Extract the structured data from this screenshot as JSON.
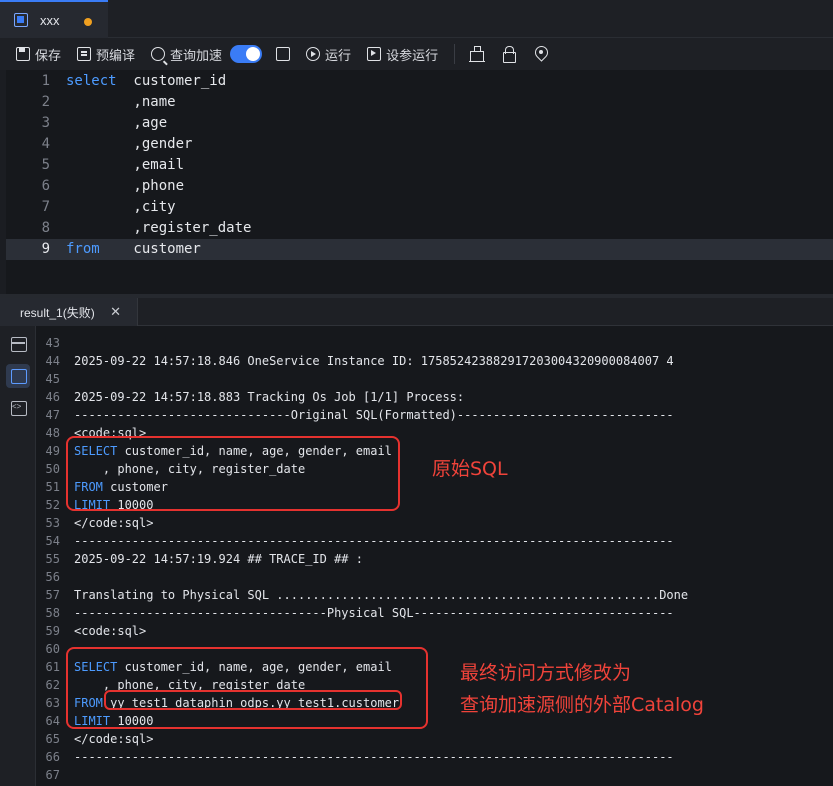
{
  "tab": {
    "title": "xxx",
    "unsaved_color": "#f0a020",
    "icon": "sql-file-icon"
  },
  "toolbar": {
    "save": "保存",
    "precompile": "预编译",
    "query_accel": "查询加速",
    "query_accel_enabled": true,
    "run": "运行",
    "run_with_params": "设参运行",
    "icons": [
      "save-icon",
      "precompile-icon",
      "search-icon",
      "edit-icon",
      "play-icon",
      "debug-run-icon",
      "warehouse-icon",
      "lock-icon",
      "location-pin-icon"
    ]
  },
  "editor": {
    "active_line": 9,
    "lines": [
      {
        "n": "1",
        "kw": "select",
        "code": "  customer_id"
      },
      {
        "n": "2",
        "kw": "",
        "code": "        ,name"
      },
      {
        "n": "3",
        "kw": "",
        "code": "        ,age"
      },
      {
        "n": "4",
        "kw": "",
        "code": "        ,gender"
      },
      {
        "n": "5",
        "kw": "",
        "code": "        ,email"
      },
      {
        "n": "6",
        "kw": "",
        "code": "        ,phone"
      },
      {
        "n": "7",
        "kw": "",
        "code": "        ,city"
      },
      {
        "n": "8",
        "kw": "",
        "code": "        ,register_date"
      },
      {
        "n": "9",
        "kw": "from",
        "code": "    customer"
      }
    ]
  },
  "result": {
    "tab_label": "result_1(失败)",
    "close_label": "✕",
    "side_icons": [
      "table-grid-icon",
      "log-icon",
      "code-icon"
    ],
    "log_lines": [
      {
        "n": "43",
        "kw": "",
        "text": ""
      },
      {
        "n": "44",
        "kw": "",
        "text": "2025-09-22 14:57:18.846 OneService Instance ID: 175852423882917203004320900084007 4"
      },
      {
        "n": "45",
        "kw": "",
        "text": ""
      },
      {
        "n": "46",
        "kw": "",
        "text": "2025-09-22 14:57:18.883 Tracking Os Job [1/1] Process:"
      },
      {
        "n": "47",
        "kw": "",
        "text": "------------------------------Original SQL(Formatted)------------------------------"
      },
      {
        "n": "48",
        "kw": "",
        "text": "<code:sql>"
      },
      {
        "n": "49",
        "kw": "SELECT",
        "text": " customer_id, name, age, gender, email"
      },
      {
        "n": "50",
        "kw": "",
        "text": "    , phone, city, register_date"
      },
      {
        "n": "51",
        "kw": "FROM",
        "text": " customer"
      },
      {
        "n": "52",
        "kw": "LIMIT",
        "text": " 10000"
      },
      {
        "n": "53",
        "kw": "",
        "text": "</code:sql>"
      },
      {
        "n": "54",
        "kw": "",
        "text": "-----------------------------------------------------------------------------------"
      },
      {
        "n": "55",
        "kw": "",
        "text": "2025-09-22 14:57:19.924 ## TRACE_ID ## :"
      },
      {
        "n": "56",
        "kw": "",
        "text": ""
      },
      {
        "n": "57",
        "kw": "",
        "text": "Translating to Physical SQL .....................................................Done"
      },
      {
        "n": "58",
        "kw": "",
        "text": "-----------------------------------Physical SQL------------------------------------"
      },
      {
        "n": "59",
        "kw": "",
        "text": "<code:sql>"
      },
      {
        "n": "60",
        "kw": "",
        "text": ""
      },
      {
        "n": "61",
        "kw": "SELECT",
        "text": " customer_id, name, age, gender, email"
      },
      {
        "n": "62",
        "kw": "",
        "text": "    , phone, city, register_date"
      },
      {
        "n": "63",
        "kw": "FROM",
        "text": " yy_test1_dataphin_odps.yy_test1.customer"
      },
      {
        "n": "64",
        "kw": "LIMIT",
        "text": " 10000"
      },
      {
        "n": "65",
        "kw": "",
        "text": "</code:sql>"
      },
      {
        "n": "66",
        "kw": "",
        "text": "-----------------------------------------------------------------------------------"
      },
      {
        "n": "67",
        "kw": "",
        "text": ""
      }
    ]
  },
  "annotations": {
    "original_sql": "原始SQL",
    "final_line1": "最终访问方式修改为",
    "final_line2": "查询加速源侧的外部Catalog",
    "color": "#e5322f"
  }
}
